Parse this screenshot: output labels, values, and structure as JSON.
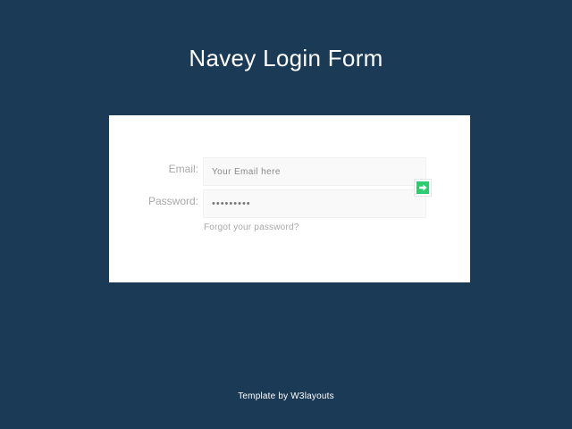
{
  "page": {
    "title": "Navey Login Form"
  },
  "form": {
    "email": {
      "label": "Email:",
      "placeholder": "Your Email here",
      "value": ""
    },
    "password": {
      "label": "Password:",
      "value": "password1"
    },
    "submit": {
      "icon": "arrow-right-icon",
      "color": "#2ecc71"
    },
    "forgot_link": "Forgot your password?"
  },
  "footer": {
    "text": "Template by W3layouts"
  },
  "colors": {
    "background": "#1b3a56",
    "card": "#ffffff",
    "accent": "#2ecc71"
  }
}
